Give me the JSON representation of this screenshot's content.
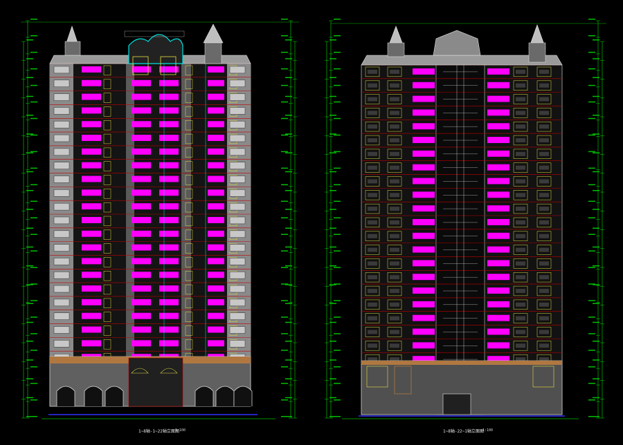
{
  "drawing": {
    "background": "#000000",
    "colors": {
      "magenta": "#ff00ff",
      "grey": "#8a8a8a",
      "green": "#00c000",
      "red": "#c00000",
      "cyan": "#00e0e0",
      "yellow": "#e8e040",
      "white": "#e8e8e8",
      "blue": "#3030ff",
      "brown": "#b07840"
    },
    "left_elevation": {
      "caption": "1~8轴-1~22轴立面图",
      "scale": "1:100"
    },
    "right_elevation": {
      "caption": "1~8轴-22~1轴立面图",
      "scale": "1:100"
    }
  }
}
